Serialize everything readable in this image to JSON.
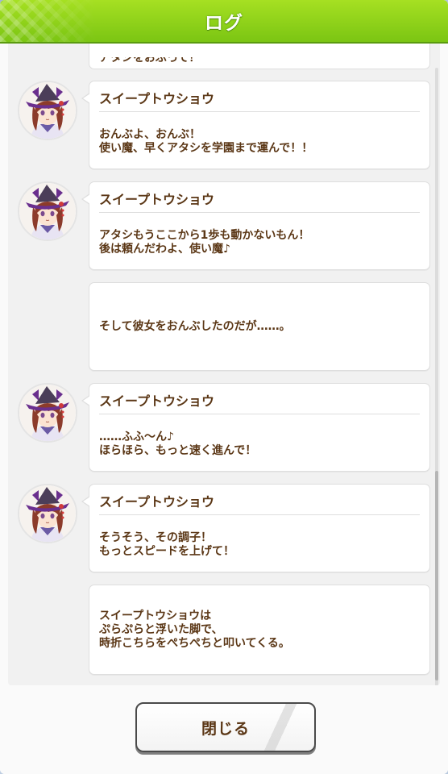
{
  "header": {
    "title": "ログ"
  },
  "partial_entry": {
    "text": "アタシをおぶって！"
  },
  "entries": [
    {
      "type": "speech",
      "speaker": "スイープトウショウ",
      "text": "おんぶよ、おんぶ！\n使い魔、早くアタシを学園まで運んで！！"
    },
    {
      "type": "speech",
      "speaker": "スイープトウショウ",
      "text": "アタシもうここから1歩も動かないもん！\n後は頼んだわよ、使い魔♪"
    },
    {
      "type": "narration",
      "text": "そして彼女をおんぶしたのだが……。"
    },
    {
      "type": "speech",
      "speaker": "スイープトウショウ",
      "text": "……ふふ～ん♪\nほらほら、もっと速く進んで！"
    },
    {
      "type": "speech",
      "speaker": "スイープトウショウ",
      "text": "そうそう、その調子！\nもっとスピードを上げて！"
    },
    {
      "type": "narration",
      "text": "スイープトウショウは\nぷらぷらと浮いた脚で、\n時折こちらをぺちぺちと叩いてくる。"
    }
  ],
  "footer": {
    "close_label": "閉じる"
  },
  "colors": {
    "header_green": "#8fd11b",
    "text_brown": "#5b3716",
    "hat_purple": "#4b3e59",
    "hat_brim": "#6a2f8e",
    "hair_brown": "#8c3b2b"
  }
}
